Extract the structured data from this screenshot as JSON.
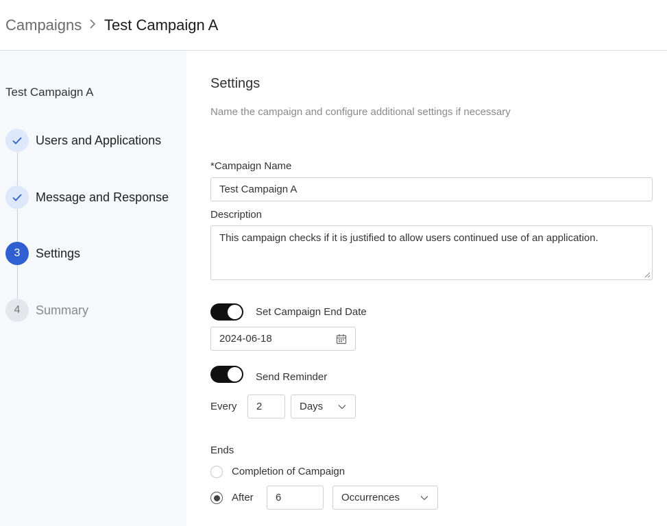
{
  "breadcrumb": {
    "root": "Campaigns",
    "current": "Test Campaign A"
  },
  "sidebar": {
    "title": "Test Campaign A",
    "steps": [
      {
        "number": "",
        "label": "Users and Applications",
        "state": "done"
      },
      {
        "number": "",
        "label": "Message and Response",
        "state": "done"
      },
      {
        "number": "3",
        "label": "Settings",
        "state": "active"
      },
      {
        "number": "4",
        "label": "Summary",
        "state": "pending"
      }
    ]
  },
  "main": {
    "title": "Settings",
    "subtitle": "Name the campaign and configure additional settings if necessary",
    "campaign_name": {
      "label": "*Campaign Name",
      "value": "Test Campaign A"
    },
    "description": {
      "label": "Description",
      "value": "This campaign checks if it is justified to allow users continued use of an application."
    },
    "end_date": {
      "toggle_label": "Set Campaign End Date",
      "toggle_on": true,
      "value": "2024-06-18"
    },
    "reminder": {
      "toggle_label": "Send Reminder",
      "toggle_on": true,
      "every_label": "Every",
      "interval_value": "2",
      "unit": "Days"
    },
    "ends": {
      "label": "Ends",
      "option_completion": "Completion of Campaign",
      "option_after": "After",
      "selected": "after",
      "after_value": "6",
      "after_unit": "Occurrences"
    }
  },
  "colors": {
    "accent": "#2f5fd0",
    "done_step_bg": "#dde9fa",
    "sidebar_bg": "#f7f8fc",
    "toggle_on": "#111111"
  }
}
